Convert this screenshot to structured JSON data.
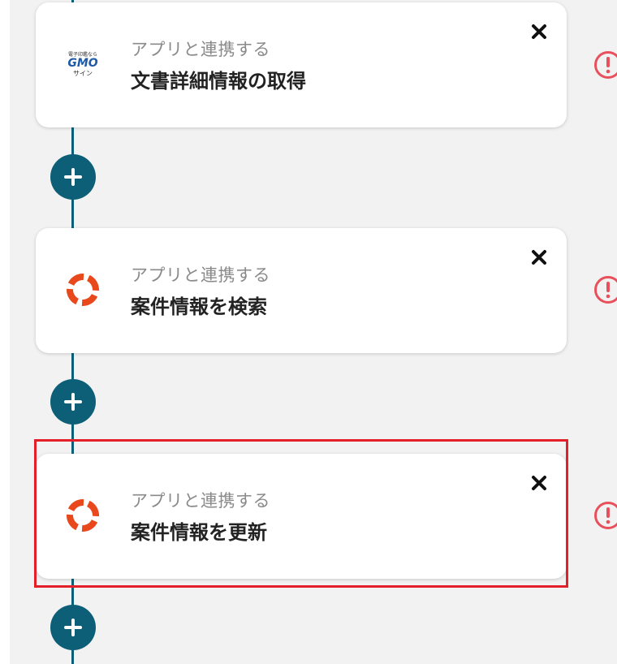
{
  "flow": {
    "steps": [
      {
        "app": "GMOサイン",
        "logo_icon": "gmo-sign-logo",
        "logo_text": {
          "small": "電子印鑑なら",
          "big": "GMO",
          "sign": "サイン"
        },
        "subtitle": "アプリと連携する",
        "title": "文書詳細情報の取得"
      },
      {
        "app": "Lifebuoy-style app",
        "logo_icon": "lifebuoy-logo",
        "subtitle": "アプリと連携する",
        "title": "案件情報を検索"
      },
      {
        "app": "Lifebuoy-style app",
        "logo_icon": "lifebuoy-logo",
        "subtitle": "アプリと連携する",
        "title": "案件情報を更新",
        "selected": true
      }
    ]
  },
  "colors": {
    "flow_line": "#0d5f78",
    "add_button": "#0d5f78",
    "warning": "#e8505b",
    "selection": "#e3202a",
    "logo_orange": "#e8481c"
  },
  "icons": {
    "close": "close-icon",
    "add": "plus-icon",
    "warning": "warning-icon"
  }
}
